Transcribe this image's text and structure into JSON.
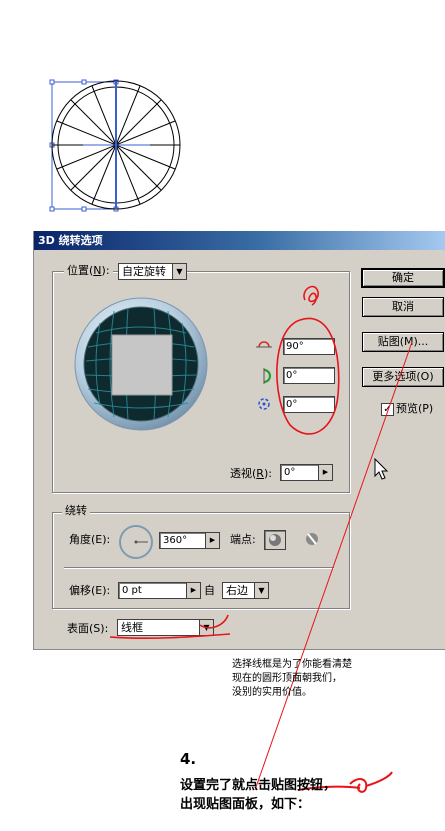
{
  "dialog": {
    "title": "3D 绕转选项",
    "position_group": {
      "label_prefix": "位置(",
      "label_key": "N",
      "label_suffix": "):",
      "preset_value": "自定旋转",
      "x_angle": "90°",
      "y_angle": "0°",
      "z_angle": "0°",
      "perspective_prefix": "透视(",
      "perspective_key": "R",
      "perspective_suffix": "):",
      "perspective_value": "0°"
    },
    "buttons": {
      "ok": "确定",
      "cancel": "取消",
      "map": "贴图(M)...",
      "more_options": "更多选项(O)",
      "preview_label": "预览(P)",
      "preview_checked": true
    },
    "revolve_group": {
      "label": "绕转",
      "angle_label": "角度(E):",
      "angle_value": "360°",
      "cap_label": "端点:",
      "offset_label": "偏移(E):",
      "offset_value": "0 pt",
      "from_label": "自",
      "from_value": "右边"
    },
    "surface": {
      "label": "表面(S):",
      "value": "线框"
    }
  },
  "annotations": {
    "caption_lines": [
      "选择线框是为了你能看清楚",
      "现在的圆形顶面朝我们，",
      "没别的实用价值。"
    ],
    "step_number": "4.",
    "step_lines": [
      "设置完了就点击贴图按钮，",
      "出现贴图面板，如下："
    ],
    "ink_color": "#e8141a",
    "title_gradient_start": "#0a246a"
  }
}
